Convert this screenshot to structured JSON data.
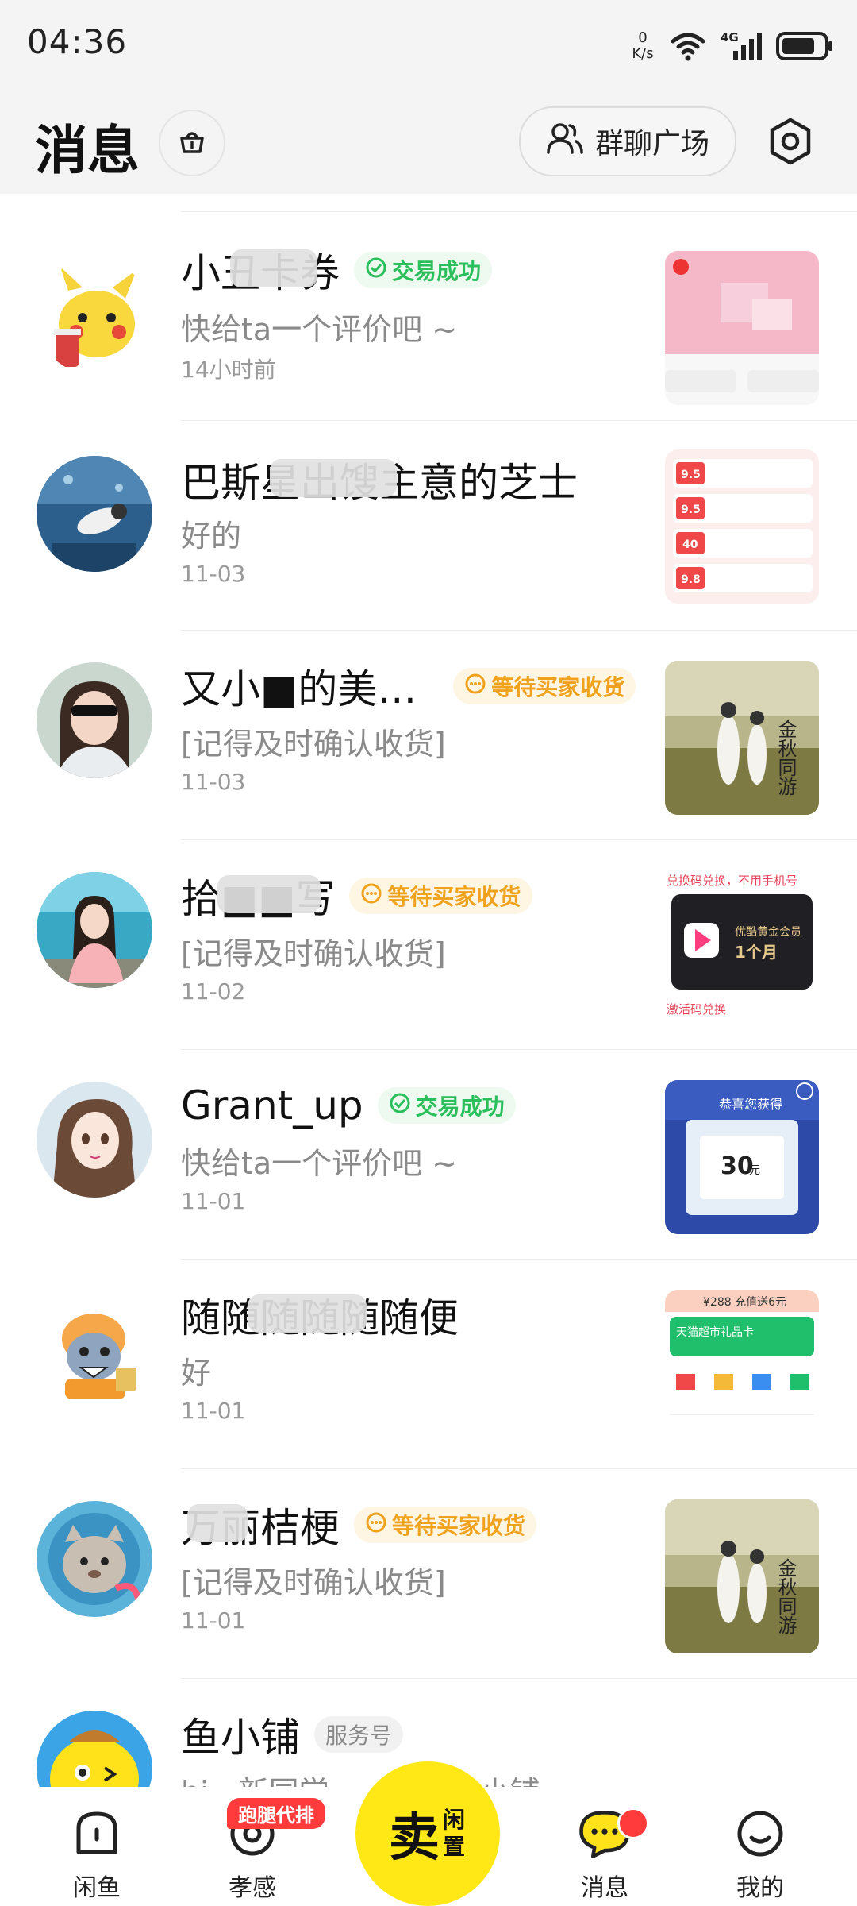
{
  "status_bar": {
    "time": "04:36",
    "net_speed_value": "0",
    "net_speed_unit": "K/s",
    "network": "4G"
  },
  "header": {
    "title": "消息",
    "group_chat_label": "群聊广场"
  },
  "messages": [
    {
      "name": "小丑卡券",
      "tag": "交易成功",
      "tag_type": "success",
      "preview": "快给ta一个评价吧 ~",
      "time": "14小时前"
    },
    {
      "name": "巴斯星出馊主意的芝士",
      "tag": "",
      "tag_type": "",
      "preview": "好的",
      "time": "11-03"
    },
    {
      "name": "又小■的美…",
      "tag": "等待买家收货",
      "tag_type": "waiting",
      "preview": "[记得及时确认收货]",
      "time": "11-03"
    },
    {
      "name": "拾■■写",
      "tag": "等待买家收货",
      "tag_type": "waiting",
      "preview": "[记得及时确认收货]",
      "time": "11-02"
    },
    {
      "name": "Grant_up",
      "tag": "交易成功",
      "tag_type": "success",
      "preview": "快给ta一个评价吧 ~",
      "time": "11-01"
    },
    {
      "name": "随随随随随随便",
      "tag": "",
      "tag_type": "",
      "preview": "好",
      "time": "11-01"
    },
    {
      "name": "万丽桔梗",
      "tag": "等待买家收货",
      "tag_type": "waiting",
      "preview": "[记得及时确认收货]",
      "time": "11-01"
    },
    {
      "name": "鱼小铺",
      "tag": "服务号",
      "tag_type": "service",
      "preview": "hi，新同学，……到鱼小铺",
      "time": ""
    }
  ],
  "thumb_texts": {
    "t2_rows": [
      "9.5",
      "9.5",
      "40",
      "9.8"
    ],
    "t4_top": "兑换码兑换，不用手机号",
    "t4_card_title": "优酷黄金会员",
    "t4_card_sub": "1个月",
    "t4_bottom": "激活码兑换",
    "t5_title": "恭喜您获得",
    "t5_value": "30",
    "t5_unit": "元",
    "t6_top": "¥288 充值送6元",
    "t6_card": "天猫超市礼品卡",
    "t3_art": "金秋同游",
    "t7_art": "金秋同游"
  },
  "bottom_nav": {
    "tabs": [
      "闲鱼",
      "孝感",
      "消息",
      "我的"
    ],
    "sell_label": "卖",
    "sell_sub": "闲置",
    "promo_badge": "跑腿代排"
  },
  "colors": {
    "accent_yellow": "#ffe815",
    "success_green": "#2bbf5b",
    "waiting_orange": "#f0a21c",
    "badge_red": "#ff3b3b"
  },
  "icons": [
    "basket-icon",
    "people-icon",
    "settings-icon",
    "home-icon",
    "location-icon",
    "chat-icon",
    "smile-icon",
    "check-circle-icon",
    "dots-circle-icon"
  ]
}
